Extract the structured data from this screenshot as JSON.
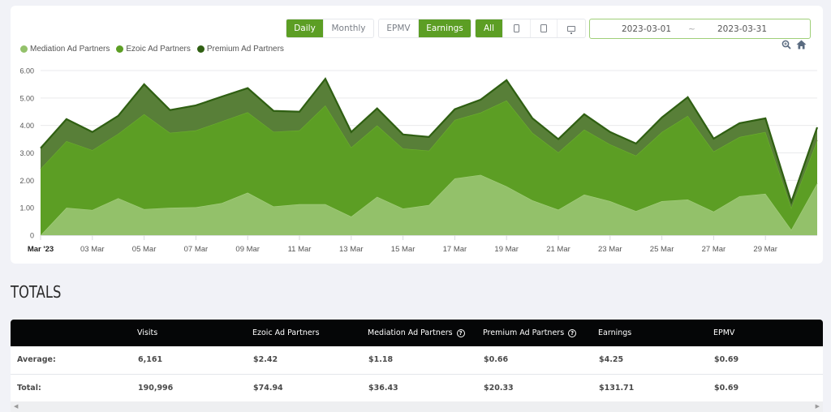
{
  "controls": {
    "period": [
      {
        "label": "Daily",
        "active": true
      },
      {
        "label": "Monthly",
        "active": false
      }
    ],
    "metric": [
      {
        "label": "EPMV",
        "active": false
      },
      {
        "label": "Earnings",
        "active": true
      }
    ],
    "device": [
      {
        "label": "All",
        "icon": null,
        "active": true
      },
      {
        "label": "",
        "icon": "mobile-icon",
        "active": false
      },
      {
        "label": "",
        "icon": "tablet-icon",
        "active": false
      },
      {
        "label": "",
        "icon": "desktop-icon",
        "active": false
      }
    ],
    "date_start": "2023-03-01",
    "date_separator": "~",
    "date_end": "2023-03-31",
    "tools": [
      "zoom-icon",
      "home-icon"
    ]
  },
  "chart_data": {
    "type": "area",
    "stacked": true,
    "title": "",
    "xlabel": "",
    "ylabel": "",
    "ylim": [
      0,
      6
    ],
    "yticks": [
      "0",
      "1.00",
      "2.00",
      "3.00",
      "4.00",
      "5.00",
      "6.00"
    ],
    "grid": true,
    "legend_position": "top-left",
    "x": [
      "Mar '23",
      "02 Mar",
      "03 Mar",
      "04 Mar",
      "05 Mar",
      "06 Mar",
      "07 Mar",
      "08 Mar",
      "09 Mar",
      "10 Mar",
      "11 Mar",
      "12 Mar",
      "13 Mar",
      "14 Mar",
      "15 Mar",
      "16 Mar",
      "17 Mar",
      "18 Mar",
      "19 Mar",
      "20 Mar",
      "21 Mar",
      "22 Mar",
      "23 Mar",
      "24 Mar",
      "25 Mar",
      "26 Mar",
      "27 Mar",
      "28 Mar",
      "29 Mar",
      "30 Mar",
      "31 Mar"
    ],
    "xticks": [
      "Mar '23",
      "03 Mar",
      "05 Mar",
      "07 Mar",
      "09 Mar",
      "11 Mar",
      "13 Mar",
      "15 Mar",
      "17 Mar",
      "19 Mar",
      "21 Mar",
      "23 Mar",
      "25 Mar",
      "27 Mar",
      "29 Mar"
    ],
    "series": [
      {
        "name": "Mediation Ad Partners",
        "color": "#93c16a",
        "values": [
          0.0,
          1.0,
          0.92,
          1.35,
          0.95,
          1.0,
          1.02,
          1.17,
          1.55,
          1.05,
          1.13,
          1.13,
          0.68,
          1.4,
          0.97,
          1.1,
          2.07,
          2.2,
          1.78,
          1.27,
          0.93,
          1.48,
          1.24,
          0.88,
          1.24,
          1.3,
          0.86,
          1.42,
          1.51,
          0.2,
          1.89
        ]
      },
      {
        "name": "Ezoic Ad Partners",
        "color": "#5c9e24",
        "values": [
          2.42,
          2.43,
          2.18,
          2.35,
          3.46,
          2.73,
          2.8,
          2.98,
          2.93,
          2.72,
          2.69,
          3.6,
          2.52,
          2.6,
          2.19,
          1.98,
          2.13,
          2.27,
          3.13,
          2.46,
          2.09,
          2.37,
          2.07,
          2.02,
          2.52,
          3.05,
          2.19,
          2.16,
          2.25,
          0.8,
          1.57
        ]
      },
      {
        "name": "Premium Ad Partners",
        "color": "#3f6d1c",
        "values": [
          0.75,
          0.8,
          0.66,
          0.65,
          1.09,
          0.83,
          0.91,
          0.9,
          0.88,
          0.76,
          0.68,
          0.97,
          0.56,
          0.62,
          0.51,
          0.5,
          0.39,
          0.47,
          0.74,
          0.53,
          0.48,
          0.56,
          0.45,
          0.44,
          0.53,
          0.68,
          0.47,
          0.5,
          0.5,
          0.21,
          0.47
        ]
      }
    ]
  },
  "totals": {
    "title": "TOTALS",
    "columns": [
      {
        "label": "",
        "help": false
      },
      {
        "label": "Visits",
        "help": false
      },
      {
        "label": "Ezoic Ad Partners",
        "help": false
      },
      {
        "label": "Mediation Ad Partners",
        "help": true
      },
      {
        "label": "Premium Ad Partners",
        "help": true
      },
      {
        "label": "Earnings",
        "help": false
      },
      {
        "label": "EPMV",
        "help": false
      }
    ],
    "help_glyph": "?",
    "rows": [
      [
        "Average:",
        "6,161",
        "$2.42",
        "$1.18",
        "$0.66",
        "$4.25",
        "$0.69"
      ],
      [
        "Total:",
        "190,996",
        "$74.94",
        "$36.43",
        "$20.33",
        "$131.71",
        "$0.69"
      ]
    ],
    "scroll_left": "◀",
    "scroll_right": "▶"
  }
}
